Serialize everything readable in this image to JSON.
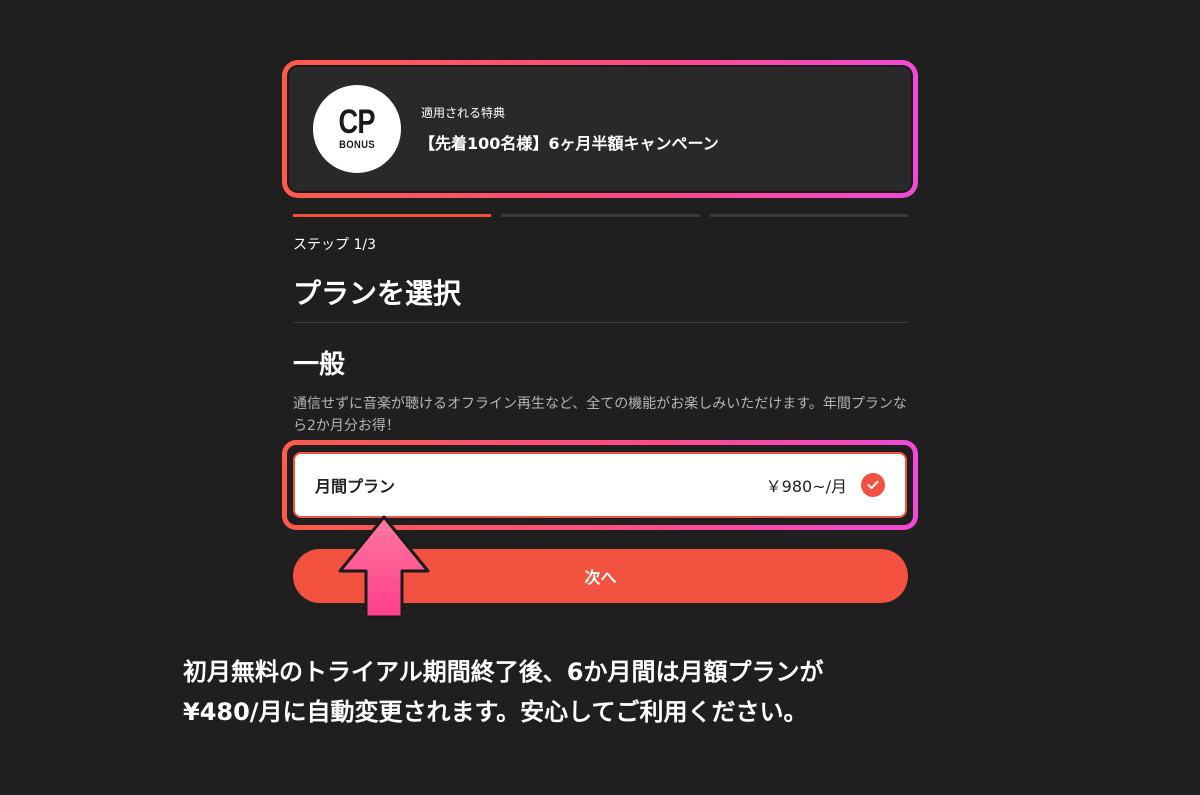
{
  "bonus": {
    "badge_big": "CP",
    "badge_small": "BONUS",
    "caption": "適用される特典",
    "title": "【先着100名様】6ヶ月半額キャンペーン"
  },
  "progress": {
    "current_step": 1,
    "total_steps": 3
  },
  "step_label": "ステップ 1/3",
  "page_title": "プランを選択",
  "section": {
    "title": "一般",
    "description": "通信せずに音楽が聴けるオフライン再生など、全ての機能がお楽しみいただけます。年間プランなら2か月分お得！"
  },
  "plan": {
    "name": "月間プラン",
    "price": "￥980~/月",
    "selected": true
  },
  "next_button_label": "次へ",
  "notice": {
    "line1": "初月無料のトライアル期間終了後、6か月間は月額プランが",
    "line2": "¥480/月に自動変更されます。安心してご利用ください。"
  },
  "colors": {
    "background": "#1f1f1f",
    "accent": "#f2523f",
    "highlight_gradient_start": "#ff5a4a",
    "highlight_gradient_end": "#f04ad8"
  }
}
